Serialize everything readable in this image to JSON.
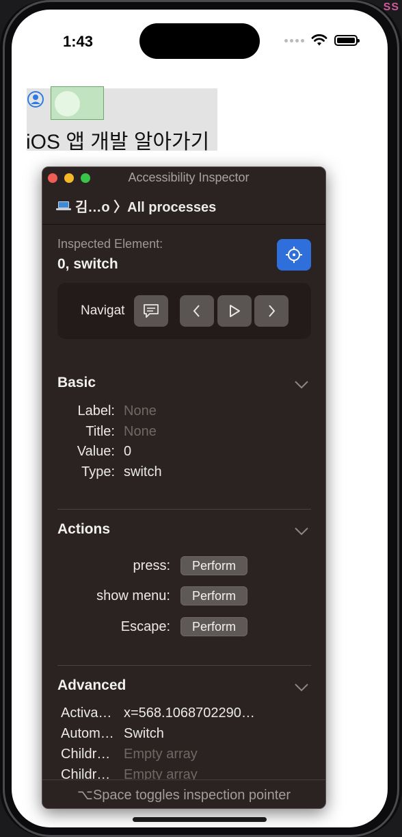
{
  "device": {
    "status_time": "1:43",
    "corner_text": "SS"
  },
  "app": {
    "title": "iOS 앱 개발 알아가기",
    "switch_on": false
  },
  "inspector": {
    "window_title": "Accessibility Inspector",
    "process_selector": "김…o 〉All processes",
    "inspected_label": "Inspected Element:",
    "inspected_value": "0, switch",
    "navigation_label": "Navigat",
    "basic": {
      "title": "Basic",
      "rows": [
        {
          "key": "Label:",
          "value": "None",
          "dim": true
        },
        {
          "key": "Title:",
          "value": "None",
          "dim": true
        },
        {
          "key": "Value:",
          "value": "0",
          "dim": false
        },
        {
          "key": "Type:",
          "value": "switch",
          "dim": false
        }
      ]
    },
    "actions": {
      "title": "Actions",
      "button_label": "Perform",
      "items": [
        "press:",
        "show menu:",
        "Escape:"
      ]
    },
    "advanced": {
      "title": "Advanced",
      "rows": [
        {
          "key": "Activa…",
          "value": "x=568.1068702290…",
          "dim": false
        },
        {
          "key": "Autom…",
          "value": "Switch",
          "dim": false
        },
        {
          "key": "Childr…",
          "value": "Empty array",
          "dim": true
        },
        {
          "key": "Childr…",
          "value": "Empty array",
          "dim": true
        }
      ]
    },
    "footer": "⌥Space toggles inspection pointer"
  },
  "colors": {
    "accent": "#2f6fdc",
    "panel_bg": "#2b2321",
    "switch_off_green": "#c2e3c0"
  }
}
